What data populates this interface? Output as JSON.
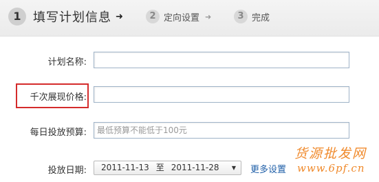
{
  "steps": [
    {
      "number": "1",
      "label": "填写计划信息",
      "arrow": "➜"
    },
    {
      "number": "2",
      "label": "定向设置",
      "arrow": "➜"
    },
    {
      "number": "3",
      "label": "完成"
    }
  ],
  "form": {
    "plan_name": {
      "label": "计划名称:",
      "value": ""
    },
    "cpm_price": {
      "label": "千次展现价格:",
      "value": ""
    },
    "daily_budget": {
      "label": "每日投放预算:",
      "placeholder": "最低预算不能低于100元"
    },
    "launch_date": {
      "label": "投放日期:",
      "start": "2011-11-13",
      "separator": "至",
      "end": "2011-11-28",
      "caret": "▼"
    },
    "more_settings_label": "更多设置"
  },
  "watermark": {
    "line1": "货源批发网",
    "line2": "www.6pf.cn"
  },
  "colors": {
    "highlight": "#d42b2b",
    "link": "#1f5fa8",
    "watermark": "#f08a2c"
  }
}
